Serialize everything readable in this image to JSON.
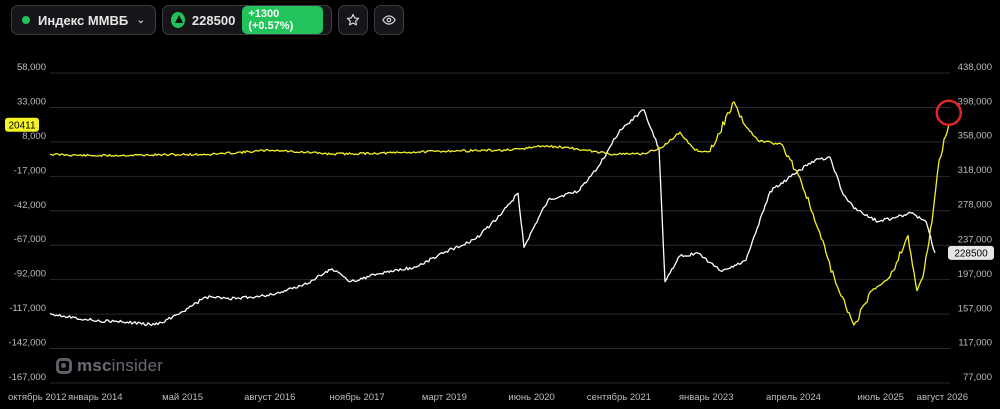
{
  "toolbar": {
    "ticker_name": "Индекс ММВБ",
    "price": "228500",
    "change_badge": "+1300 (+0.57%)",
    "icons": [
      "status-dot",
      "chevron-down-icon",
      "up-arrow-icon",
      "star-icon",
      "eye-icon"
    ]
  },
  "watermark": {
    "brand_a": "msc",
    "brand_b": "insider"
  },
  "colors": {
    "background": "#000000",
    "series_a": "#f2f224",
    "series_b": "#ffffff",
    "accent_green": "#21c35a",
    "highlight_circle": "#e0252b"
  },
  "chart_data": {
    "type": "line",
    "x": [
      "октябрь 2012",
      "январь 2014",
      "май 2015",
      "август 2016",
      "ноябрь 2017",
      "март 2019",
      "июнь 2020",
      "сентябрь 2021",
      "январь 2023",
      "апрель 2024",
      "июль 2025",
      "август 2026"
    ],
    "left_axis": {
      "ticks": [
        "58,000",
        "33,000",
        "8,000",
        "-17,000",
        "-42,000",
        "-67,000",
        "-92,000",
        "-117,000",
        "-142,000",
        "-167,000"
      ],
      "ylim": [
        -167000,
        58000
      ]
    },
    "right_axis": {
      "ticks": [
        "438,000",
        "398,000",
        "358,000",
        "318,000",
        "278,000",
        "237,000",
        "197,000",
        "157,000",
        "117,000",
        "77,000"
      ],
      "ylim": [
        77000,
        438000
      ]
    },
    "series": [
      {
        "axis": "left",
        "color": "#f2f224",
        "last_value_label": "20411",
        "points": [
          [
            2012.8,
            -1000
          ],
          [
            2013.5,
            -2000
          ],
          [
            2014.5,
            -1500
          ],
          [
            2015.5,
            -1000
          ],
          [
            2016.5,
            2000
          ],
          [
            2017.5,
            -800
          ],
          [
            2018.5,
            0
          ],
          [
            2019.5,
            1500
          ],
          [
            2020.5,
            2000
          ],
          [
            2021.0,
            5000
          ],
          [
            2021.4,
            4000
          ],
          [
            2021.7,
            2000
          ],
          [
            2022.2,
            -1000
          ],
          [
            2022.7,
            -500
          ],
          [
            2023.0,
            4000
          ],
          [
            2023.3,
            15000
          ],
          [
            2023.55,
            2000
          ],
          [
            2023.8,
            1000
          ],
          [
            2024.2,
            37000
          ],
          [
            2024.35,
            22000
          ],
          [
            2024.6,
            9000
          ],
          [
            2025.0,
            6000
          ],
          [
            2025.3,
            -18000
          ],
          [
            2025.6,
            -55000
          ],
          [
            2025.9,
            -95000
          ],
          [
            2026.2,
            -125000
          ],
          [
            2026.5,
            -100000
          ],
          [
            2026.8,
            -90000
          ],
          [
            2027.1,
            -60000
          ],
          [
            2027.25,
            -100000
          ],
          [
            2027.35,
            -90000
          ],
          [
            2027.5,
            -50000
          ],
          [
            2027.62,
            -5000
          ],
          [
            2027.78,
            20411
          ]
        ]
      },
      {
        "axis": "right",
        "color": "#ffffff",
        "last_value_label": "228500",
        "points": [
          [
            2012.8,
            158000
          ],
          [
            2013.5,
            150000
          ],
          [
            2014.0,
            148000
          ],
          [
            2014.6,
            145000
          ],
          [
            2015.0,
            160000
          ],
          [
            2015.4,
            177000
          ],
          [
            2015.9,
            175000
          ],
          [
            2016.5,
            180000
          ],
          [
            2017.0,
            190000
          ],
          [
            2017.5,
            210000
          ],
          [
            2017.8,
            195000
          ],
          [
            2018.4,
            206000
          ],
          [
            2018.9,
            212000
          ],
          [
            2019.4,
            230000
          ],
          [
            2019.9,
            245000
          ],
          [
            2020.3,
            272000
          ],
          [
            2020.6,
            298000
          ],
          [
            2020.7,
            235000
          ],
          [
            2021.1,
            290000
          ],
          [
            2021.6,
            300000
          ],
          [
            2021.95,
            330000
          ],
          [
            2022.3,
            372000
          ],
          [
            2022.7,
            395000
          ],
          [
            2022.95,
            350000
          ],
          [
            2023.05,
            195000
          ],
          [
            2023.3,
            225000
          ],
          [
            2023.6,
            228000
          ],
          [
            2024.0,
            207000
          ],
          [
            2024.4,
            220000
          ],
          [
            2024.8,
            300000
          ],
          [
            2025.2,
            320000
          ],
          [
            2025.5,
            335000
          ],
          [
            2025.8,
            340000
          ],
          [
            2026.0,
            300000
          ],
          [
            2026.2,
            280000
          ],
          [
            2026.6,
            265000
          ],
          [
            2026.9,
            270000
          ],
          [
            2027.15,
            275000
          ],
          [
            2027.4,
            265000
          ],
          [
            2027.55,
            228500
          ]
        ]
      }
    ]
  }
}
